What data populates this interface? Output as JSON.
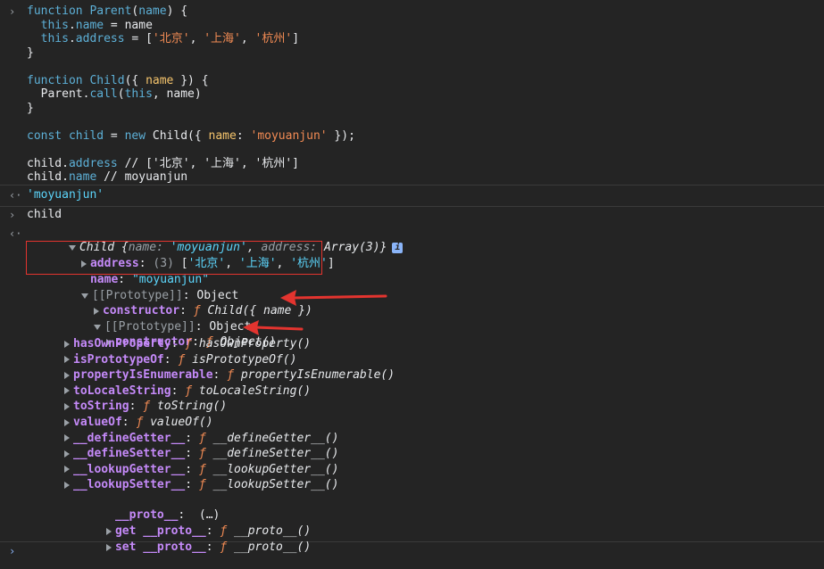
{
  "input1": {
    "lines": [
      [
        [
          "kw",
          "function "
        ],
        [
          "fn",
          "Parent"
        ],
        [
          "plain",
          "("
        ],
        [
          "kw",
          "name"
        ],
        [
          "plain",
          ") {"
        ]
      ],
      [
        [
          "plain",
          "  "
        ],
        [
          "kw",
          "this"
        ],
        [
          "plain",
          "."
        ],
        [
          "prop",
          "name"
        ],
        [
          "plain",
          " = name"
        ]
      ],
      [
        [
          "plain",
          "  "
        ],
        [
          "kw",
          "this"
        ],
        [
          "plain",
          "."
        ],
        [
          "prop",
          "address"
        ],
        [
          "plain",
          " = ["
        ],
        [
          "str",
          "'北京'"
        ],
        [
          "plain",
          ", "
        ],
        [
          "str",
          "'上海'"
        ],
        [
          "plain",
          ", "
        ],
        [
          "str",
          "'杭州'"
        ],
        [
          "plain",
          "]"
        ]
      ],
      [
        [
          "plain",
          "}"
        ]
      ],
      [
        [
          "plain",
          ""
        ]
      ],
      [
        [
          "kw",
          "function "
        ],
        [
          "fn",
          "Child"
        ],
        [
          "plain",
          "({ "
        ],
        [
          "str2",
          "name"
        ],
        [
          "plain",
          " }) {"
        ]
      ],
      [
        [
          "plain",
          "  Parent."
        ],
        [
          "prop",
          "call"
        ],
        [
          "plain",
          "("
        ],
        [
          "kw",
          "this"
        ],
        [
          "plain",
          ", name)"
        ]
      ],
      [
        [
          "plain",
          "}"
        ]
      ],
      [
        [
          "plain",
          ""
        ]
      ],
      [
        [
          "kw",
          "const "
        ],
        [
          "fn",
          "child"
        ],
        [
          "plain",
          " = "
        ],
        [
          "kw",
          "new "
        ],
        [
          "plain",
          "Child({ "
        ],
        [
          "str2",
          "name"
        ],
        [
          "plain",
          ": "
        ],
        [
          "str",
          "'moyuanjun'"
        ],
        [
          "plain",
          " });"
        ]
      ],
      [
        [
          "plain",
          ""
        ]
      ],
      [
        [
          "plain",
          "child."
        ],
        [
          "prop",
          "address"
        ],
        [
          "plain",
          " // ['北京', '上海', '杭州']"
        ]
      ],
      [
        [
          "plain",
          "child."
        ],
        [
          "prop",
          "name"
        ],
        [
          "plain",
          " // moyuanjun"
        ]
      ]
    ]
  },
  "output1": {
    "value": "'moyuanjun'"
  },
  "input2": {
    "text": "child"
  },
  "object": {
    "header_name": "Child",
    "header_preview_open": " {",
    "preview_key1": "name",
    "preview_val1": "'moyuanjun'",
    "preview_sep": ", ",
    "preview_key2": "address",
    "preview_val2": "Array(3)",
    "preview_close": "}",
    "info_icon": "i",
    "address_key": "address",
    "address_count": "(3)",
    "address_open": " [",
    "address_v1": "'北京'",
    "address_v2": "'上海'",
    "address_v3": "'杭州'",
    "address_close": "]",
    "comma": ", ",
    "name_key": "name",
    "name_val": "\"moyuanjun\"",
    "proto1_label": "[[Prototype]]",
    "proto_value": "Object",
    "constructor_key": "constructor",
    "constructor1_fn": "Child({ name })",
    "proto2_label": "[[Prototype]]",
    "constructor2_fn": "Object()",
    "methods": [
      {
        "key": "hasOwnProperty",
        "fn": "hasOwnProperty()"
      },
      {
        "key": "isPrototypeOf",
        "fn": "isPrototypeOf()"
      },
      {
        "key": "propertyIsEnumerable",
        "fn": "propertyIsEnumerable()"
      },
      {
        "key": "toLocaleString",
        "fn": "toLocaleString()"
      },
      {
        "key": "toString",
        "fn": "toString()"
      },
      {
        "key": "valueOf",
        "fn": "valueOf()"
      },
      {
        "key": "__defineGetter__",
        "fn": "__defineGetter__()"
      },
      {
        "key": "__defineSetter__",
        "fn": "__defineSetter__()"
      },
      {
        "key": "__lookupGetter__",
        "fn": "__lookupGetter__()"
      },
      {
        "key": "__lookupSetter__",
        "fn": "__lookupSetter__()"
      }
    ],
    "proto_getter_key": "__proto__",
    "proto_getter_val": "(…)",
    "get_label": "get",
    "set_label": "set",
    "get_fn": "__proto__()",
    "set_fn": "__proto__()",
    "f_symbol": "ƒ",
    "colon": ": "
  },
  "prompts": {
    "input": "›",
    "output": "‹·"
  },
  "colors": {
    "annotation_red": "#e3342f"
  }
}
